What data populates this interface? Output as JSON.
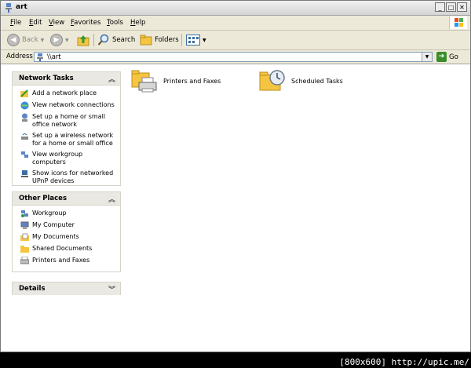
{
  "window": {
    "title": "art"
  },
  "menu": {
    "items": [
      "File",
      "Edit",
      "View",
      "Favorites",
      "Tools",
      "Help"
    ]
  },
  "toolbar": {
    "back_label": "Back",
    "search_label": "Search",
    "folders_label": "Folders"
  },
  "address": {
    "label": "Address",
    "value": "\\\\art",
    "go_label": "Go"
  },
  "sidebar": {
    "network_tasks": {
      "title": "Network Tasks",
      "items": [
        {
          "label": "Add a network place",
          "icon": "add-network-place-icon"
        },
        {
          "label": "View network connections",
          "icon": "network-connections-icon"
        },
        {
          "label": "Set up a home or small office network",
          "icon": "home-network-icon"
        },
        {
          "label": "Set up a wireless network for a home or small office",
          "icon": "wireless-network-icon"
        },
        {
          "label": "View workgroup computers",
          "icon": "workgroup-computers-icon"
        },
        {
          "label": "Show icons for networked UPnP devices",
          "icon": "upnp-devices-icon"
        }
      ]
    },
    "other_places": {
      "title": "Other Places",
      "items": [
        {
          "label": "Workgroup",
          "icon": "workgroup-icon"
        },
        {
          "label": "My Computer",
          "icon": "my-computer-icon"
        },
        {
          "label": "My Documents",
          "icon": "my-documents-icon"
        },
        {
          "label": "Shared Documents",
          "icon": "shared-documents-icon"
        },
        {
          "label": "Printers and Faxes",
          "icon": "printers-faxes-icon"
        }
      ]
    },
    "details": {
      "title": "Details"
    }
  },
  "main": {
    "items": [
      {
        "label": "Printers and Faxes",
        "icon": "printer-folder-icon"
      },
      {
        "label": "Scheduled Tasks",
        "icon": "scheduled-tasks-folder-icon"
      }
    ]
  },
  "footer": {
    "text": "[800x600] http://upic.me/"
  }
}
